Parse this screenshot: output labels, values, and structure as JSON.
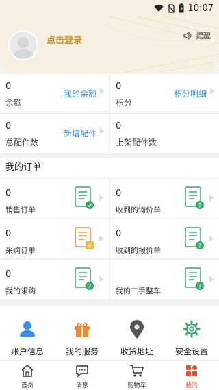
{
  "status_bar": {
    "time": "10:07"
  },
  "header": {
    "login_label": "点击登录",
    "remind_label": "提醒"
  },
  "stats": [
    {
      "value": "0",
      "label": "余额",
      "link": "我的余额"
    },
    {
      "value": "0",
      "label": "积分",
      "link": "积分明细"
    },
    {
      "value": "0",
      "label": "总配件数",
      "link": "新增配件"
    },
    {
      "value": "0",
      "label": "上架配件数",
      "link": ""
    }
  ],
  "orders": {
    "title": "我的订单",
    "items": [
      {
        "value": "0",
        "label": "销售订单",
        "badge": "check"
      },
      {
        "value": "0",
        "label": "收到的询价单",
        "badge": "question"
      },
      {
        "value": "0",
        "label": "采购订单",
        "badge": "yen"
      },
      {
        "value": "0",
        "label": "收到的报价单",
        "badge": "question"
      },
      {
        "value": "0",
        "label": "我的求购",
        "badge": "question"
      },
      {
        "value": "",
        "label": "我的二手整车",
        "badge": "question"
      }
    ]
  },
  "services": [
    {
      "label": "账户信息",
      "icon": "user-icon",
      "color": "#3a8ee6"
    },
    {
      "label": "我的服务",
      "icon": "gift-icon",
      "color": "#f08a2e"
    },
    {
      "label": "收货地址",
      "icon": "location-pin-icon",
      "color": "#555555"
    },
    {
      "label": "安全设置",
      "icon": "gear-icon",
      "color": "#3aa86b"
    }
  ],
  "nav": [
    {
      "label": "首页",
      "icon": "home-icon",
      "active": false
    },
    {
      "label": "消息",
      "icon": "message-icon",
      "active": false
    },
    {
      "label": "购物车",
      "icon": "cart-icon",
      "active": false
    },
    {
      "label": "我的",
      "icon": "grid-icon",
      "active": true
    }
  ],
  "colors": {
    "accent": "#e8532f",
    "link": "#3a8ee6",
    "gold": "#c49325",
    "green": "#3aa86b"
  }
}
